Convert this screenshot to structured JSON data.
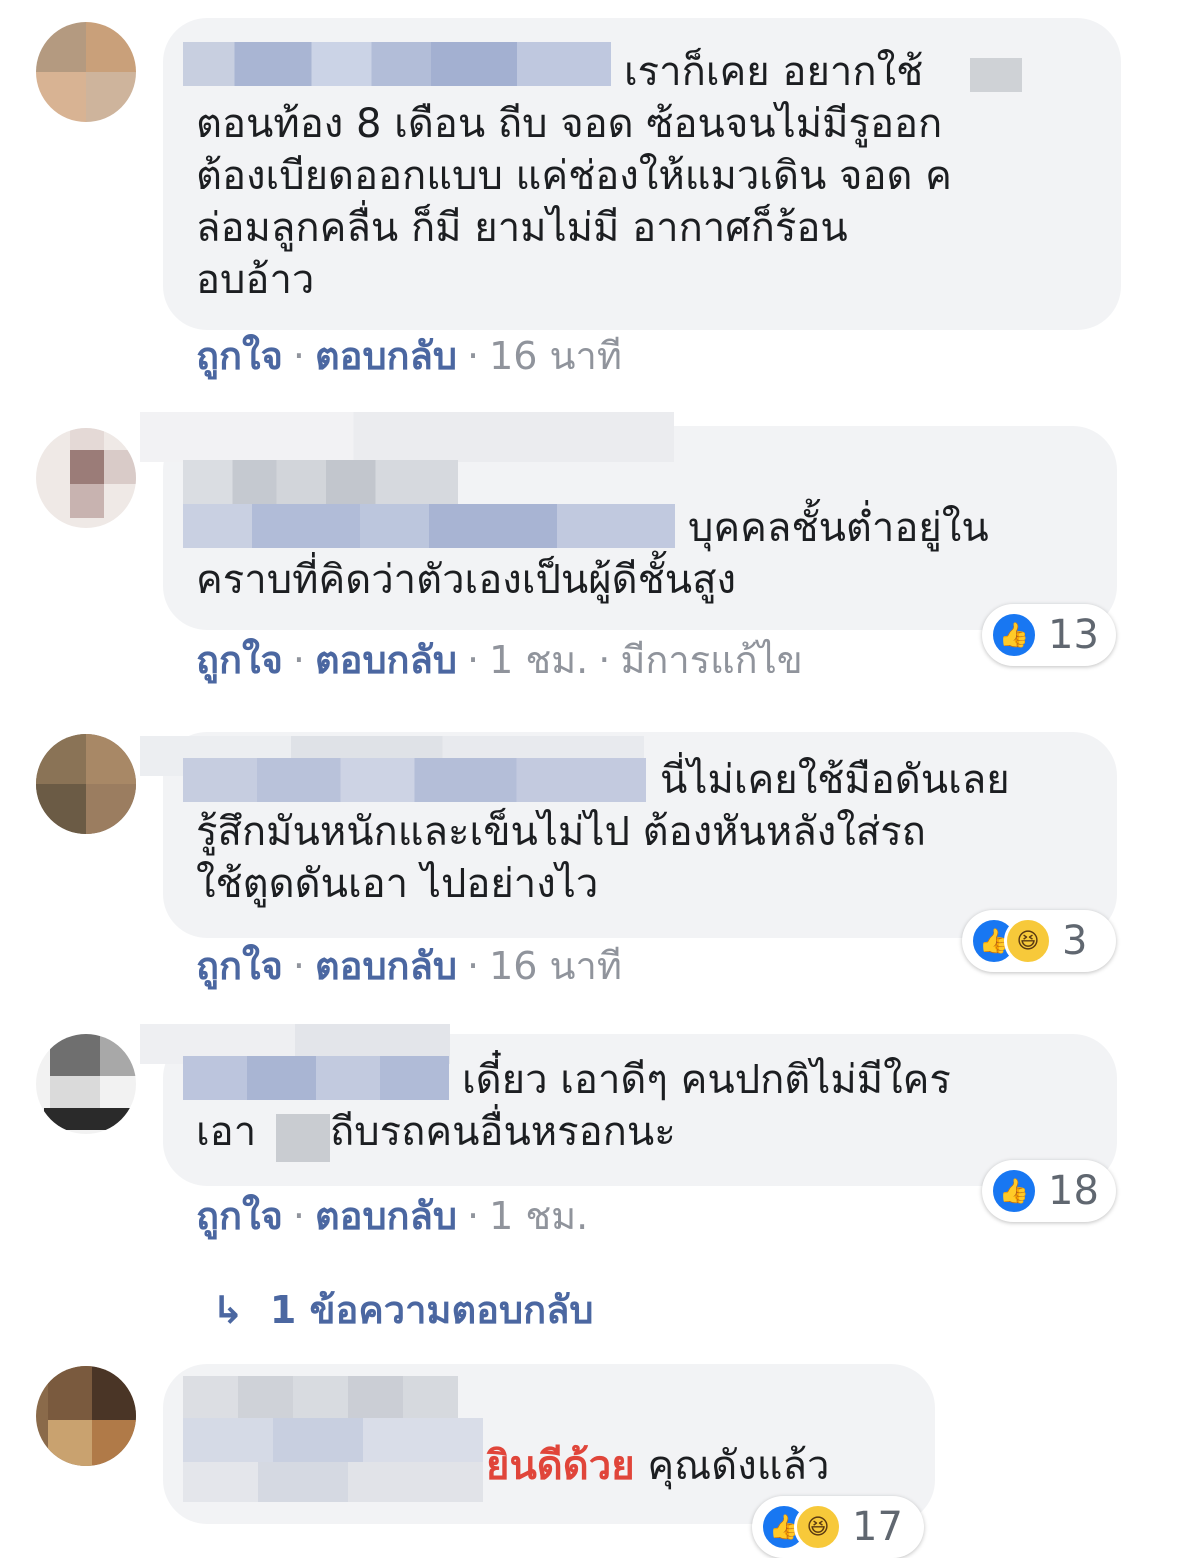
{
  "comments": [
    {
      "text_lines": [
        "เราก็เคย อยากใช้",
        "ตอนท้อง 8 เดือน ถีบ จอด ซ้อนจนไม่มีรูออก",
        "ต้องเบียดออกแบบ แค่ช่องให้แมวเดิน จอด ค",
        "ล่อมลูกคลื่น ก็มี ยามไม่มี อากาศก็ร้อน",
        "อบอ้าว"
      ],
      "like": "ถูกใจ",
      "reply": "ตอบกลับ",
      "time": "16 นาที"
    },
    {
      "text_lines": [
        "บุคคลชั้นต่ำอยู่ใน",
        "คราบที่คิดว่าตัวเองเป็นผู้ดีชั้นสูง"
      ],
      "like": "ถูกใจ",
      "reply": "ตอบกลับ",
      "time": "1 ชม.",
      "edited": "มีการแก้ไข",
      "reaction_count": "13"
    },
    {
      "text_lines": [
        "นี่ไม่เคยใช้มือดันเลย",
        "รู้สึกมันหนักและเข็นไม่ไป ต้องหันหลังใส่รถ",
        "ใช้ตูดดันเอา ไปอย่างไว"
      ],
      "like": "ถูกใจ",
      "reply": "ตอบกลับ",
      "time": "16 นาที",
      "reaction_count": "3"
    },
    {
      "text_lines": [
        "เดี๋ยว เอาดีๆ คนปกติไม่มีใคร",
        "เอา",
        "ถีบรถคนอื่นหรอกนะ"
      ],
      "like": "ถูกใจ",
      "reply": "ตอบกลับ",
      "time": "1 ชม.",
      "reaction_count": "18",
      "replies_link": "1 ข้อความตอบกลับ"
    },
    {
      "highlight": "ยินดีด้วย",
      "text_rest": "คุณดังแล้ว",
      "reaction_count": "17"
    }
  ],
  "colors": {
    "bubble": "#f2f3f5",
    "action_link": "#385898",
    "meta_gray": "#90949c",
    "like_blue": "#1877f2",
    "haha_yellow": "#f7c93a",
    "highlight_red": "#e0453a"
  },
  "icons": {
    "like": "thumbs-up-icon",
    "haha": "laughing-face-icon",
    "reply_arrow": "reply-arrow-icon"
  }
}
